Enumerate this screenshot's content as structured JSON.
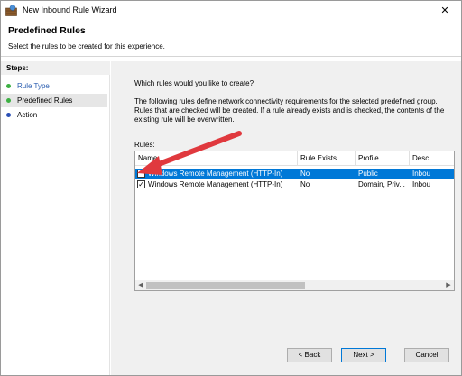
{
  "window": {
    "title": "New Inbound Rule Wizard",
    "close_glyph": "✕"
  },
  "header": {
    "title": "Predefined Rules",
    "subtitle": "Select the rules to be created for this experience."
  },
  "steps": {
    "title": "Steps:",
    "items": [
      {
        "label": "Rule Type",
        "state": "done",
        "dot_color": "#3cb043"
      },
      {
        "label": "Predefined Rules",
        "state": "current",
        "dot_color": "#3cb043"
      },
      {
        "label": "Action",
        "state": "pending",
        "dot_color": "#2a4fb5"
      }
    ]
  },
  "main": {
    "question": "Which rules would you like to create?",
    "description": "The following rules define network connectivity requirements for the selected predefined group. Rules that are checked will be created. If a rule already exists and is checked, the contents of the existing rule will be overwritten.",
    "rules_label": "Rules:"
  },
  "table": {
    "columns": [
      "Name",
      "Rule Exists",
      "Profile",
      "Desc"
    ],
    "rows": [
      {
        "checked": false,
        "name": "Windows Remote Management (HTTP-In)",
        "exists": "No",
        "profile": "Public",
        "desc": "Inbou",
        "selected": true
      },
      {
        "checked": true,
        "name": "Windows Remote Management (HTTP-In)",
        "exists": "No",
        "profile": "Domain, Priv...",
        "desc": "Inbou",
        "selected": false
      }
    ]
  },
  "scrollbar": {
    "left_glyph": "◀",
    "right_glyph": "▶"
  },
  "buttons": {
    "back": "< Back",
    "next": "Next >",
    "cancel": "Cancel"
  },
  "colors": {
    "selection": "#0078d7",
    "annotation_arrow": "#e0393e"
  }
}
